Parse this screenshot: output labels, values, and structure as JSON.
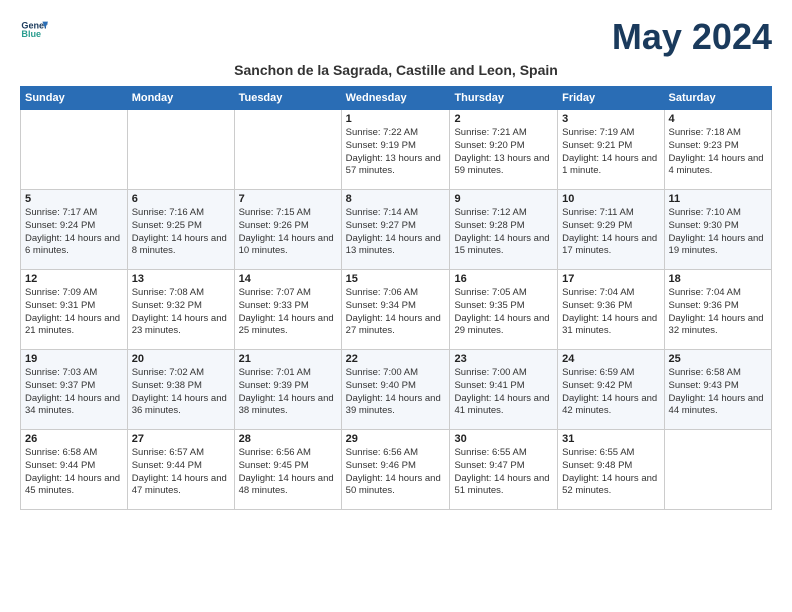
{
  "header": {
    "logo_line1": "General",
    "logo_line2": "Blue",
    "month_title": "May 2024",
    "subtitle": "Sanchon de la Sagrada, Castille and Leon, Spain"
  },
  "days_of_week": [
    "Sunday",
    "Monday",
    "Tuesday",
    "Wednesday",
    "Thursday",
    "Friday",
    "Saturday"
  ],
  "weeks": [
    [
      {
        "day": "",
        "info": ""
      },
      {
        "day": "",
        "info": ""
      },
      {
        "day": "",
        "info": ""
      },
      {
        "day": "1",
        "info": "Sunrise: 7:22 AM\nSunset: 9:19 PM\nDaylight: 13 hours and 57 minutes."
      },
      {
        "day": "2",
        "info": "Sunrise: 7:21 AM\nSunset: 9:20 PM\nDaylight: 13 hours and 59 minutes."
      },
      {
        "day": "3",
        "info": "Sunrise: 7:19 AM\nSunset: 9:21 PM\nDaylight: 14 hours and 1 minute."
      },
      {
        "day": "4",
        "info": "Sunrise: 7:18 AM\nSunset: 9:23 PM\nDaylight: 14 hours and 4 minutes."
      }
    ],
    [
      {
        "day": "5",
        "info": "Sunrise: 7:17 AM\nSunset: 9:24 PM\nDaylight: 14 hours and 6 minutes."
      },
      {
        "day": "6",
        "info": "Sunrise: 7:16 AM\nSunset: 9:25 PM\nDaylight: 14 hours and 8 minutes."
      },
      {
        "day": "7",
        "info": "Sunrise: 7:15 AM\nSunset: 9:26 PM\nDaylight: 14 hours and 10 minutes."
      },
      {
        "day": "8",
        "info": "Sunrise: 7:14 AM\nSunset: 9:27 PM\nDaylight: 14 hours and 13 minutes."
      },
      {
        "day": "9",
        "info": "Sunrise: 7:12 AM\nSunset: 9:28 PM\nDaylight: 14 hours and 15 minutes."
      },
      {
        "day": "10",
        "info": "Sunrise: 7:11 AM\nSunset: 9:29 PM\nDaylight: 14 hours and 17 minutes."
      },
      {
        "day": "11",
        "info": "Sunrise: 7:10 AM\nSunset: 9:30 PM\nDaylight: 14 hours and 19 minutes."
      }
    ],
    [
      {
        "day": "12",
        "info": "Sunrise: 7:09 AM\nSunset: 9:31 PM\nDaylight: 14 hours and 21 minutes."
      },
      {
        "day": "13",
        "info": "Sunrise: 7:08 AM\nSunset: 9:32 PM\nDaylight: 14 hours and 23 minutes."
      },
      {
        "day": "14",
        "info": "Sunrise: 7:07 AM\nSunset: 9:33 PM\nDaylight: 14 hours and 25 minutes."
      },
      {
        "day": "15",
        "info": "Sunrise: 7:06 AM\nSunset: 9:34 PM\nDaylight: 14 hours and 27 minutes."
      },
      {
        "day": "16",
        "info": "Sunrise: 7:05 AM\nSunset: 9:35 PM\nDaylight: 14 hours and 29 minutes."
      },
      {
        "day": "17",
        "info": "Sunrise: 7:04 AM\nSunset: 9:36 PM\nDaylight: 14 hours and 31 minutes."
      },
      {
        "day": "18",
        "info": "Sunrise: 7:04 AM\nSunset: 9:36 PM\nDaylight: 14 hours and 32 minutes."
      }
    ],
    [
      {
        "day": "19",
        "info": "Sunrise: 7:03 AM\nSunset: 9:37 PM\nDaylight: 14 hours and 34 minutes."
      },
      {
        "day": "20",
        "info": "Sunrise: 7:02 AM\nSunset: 9:38 PM\nDaylight: 14 hours and 36 minutes."
      },
      {
        "day": "21",
        "info": "Sunrise: 7:01 AM\nSunset: 9:39 PM\nDaylight: 14 hours and 38 minutes."
      },
      {
        "day": "22",
        "info": "Sunrise: 7:00 AM\nSunset: 9:40 PM\nDaylight: 14 hours and 39 minutes."
      },
      {
        "day": "23",
        "info": "Sunrise: 7:00 AM\nSunset: 9:41 PM\nDaylight: 14 hours and 41 minutes."
      },
      {
        "day": "24",
        "info": "Sunrise: 6:59 AM\nSunset: 9:42 PM\nDaylight: 14 hours and 42 minutes."
      },
      {
        "day": "25",
        "info": "Sunrise: 6:58 AM\nSunset: 9:43 PM\nDaylight: 14 hours and 44 minutes."
      }
    ],
    [
      {
        "day": "26",
        "info": "Sunrise: 6:58 AM\nSunset: 9:44 PM\nDaylight: 14 hours and 45 minutes."
      },
      {
        "day": "27",
        "info": "Sunrise: 6:57 AM\nSunset: 9:44 PM\nDaylight: 14 hours and 47 minutes."
      },
      {
        "day": "28",
        "info": "Sunrise: 6:56 AM\nSunset: 9:45 PM\nDaylight: 14 hours and 48 minutes."
      },
      {
        "day": "29",
        "info": "Sunrise: 6:56 AM\nSunset: 9:46 PM\nDaylight: 14 hours and 50 minutes."
      },
      {
        "day": "30",
        "info": "Sunrise: 6:55 AM\nSunset: 9:47 PM\nDaylight: 14 hours and 51 minutes."
      },
      {
        "day": "31",
        "info": "Sunrise: 6:55 AM\nSunset: 9:48 PM\nDaylight: 14 hours and 52 minutes."
      },
      {
        "day": "",
        "info": ""
      }
    ]
  ]
}
